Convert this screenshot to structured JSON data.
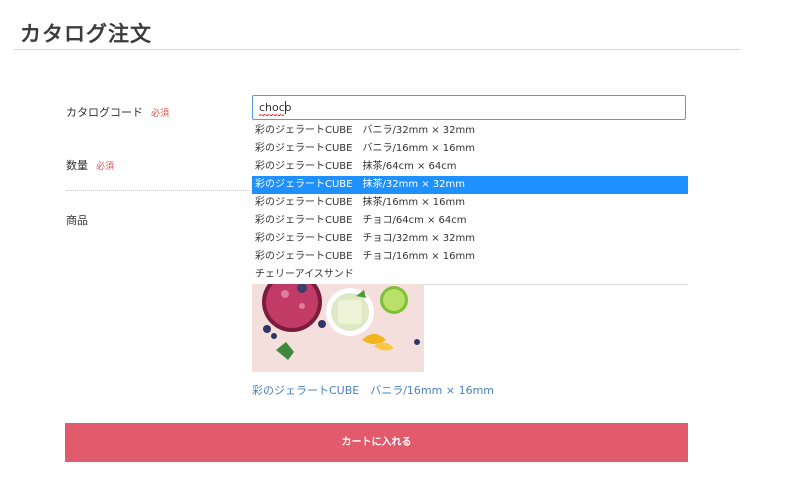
{
  "page": {
    "title": "カタログ注文"
  },
  "form": {
    "required_mark": "必須",
    "catalog_code": {
      "label": "カタログコード",
      "value": "choco"
    },
    "quantity": {
      "label": "数量"
    },
    "product": {
      "label": "商品"
    }
  },
  "autocomplete": {
    "items": [
      {
        "label": "彩のジェラートCUBE　バニラ/32mm × 32mm",
        "selected": false
      },
      {
        "label": "彩のジェラートCUBE　バニラ/16mm × 16mm",
        "selected": false
      },
      {
        "label": "彩のジェラートCUBE　抹茶/64cm × 64cm",
        "selected": false
      },
      {
        "label": "彩のジェラートCUBE　抹茶/32mm × 32mm",
        "selected": true
      },
      {
        "label": "彩のジェラートCUBE　抹茶/16mm × 16mm",
        "selected": false
      },
      {
        "label": "彩のジェラートCUBE　チョコ/64cm × 64cm",
        "selected": false
      },
      {
        "label": "彩のジェラートCUBE　チョコ/32mm × 32mm",
        "selected": false
      },
      {
        "label": "彩のジェラートCUBE　チョコ/16mm × 16mm",
        "selected": false
      },
      {
        "label": "チェリーアイスサンド",
        "selected": false
      }
    ]
  },
  "product": {
    "caption": "彩のジェラートCUBE　バニラ/16mm × 16mm"
  },
  "cart_button": {
    "label": "カートに入れる"
  },
  "colors": {
    "accent_blue": "#1e90ff",
    "cart_button": "#e25b6c",
    "link_blue": "#4a7fc1",
    "required_red": "#d9534f"
  }
}
